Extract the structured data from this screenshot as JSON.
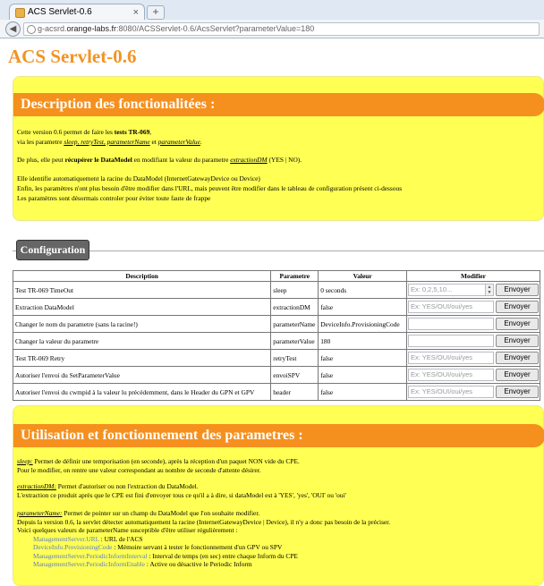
{
  "browser": {
    "tab_title": "ACS Servlet-0.6",
    "tab_close": "×",
    "new_tab": "+",
    "url_prefix": "g-acsrd.",
    "url_host": "orange-labs.fr",
    "url_rest": ":8080/ACSServlet-0.6/AcsServlet?parameterValue=180"
  },
  "page": {
    "title": "ACS Servlet-0.6",
    "description": {
      "heading": "Description des fonctionalitées :",
      "l1a": "Cette version 0.6 permet de faire les ",
      "l1b": "tests TR-069",
      "l1c": ",",
      "l2a": "via les parametre ",
      "l2b": "sleep, retryTest, parameterName",
      "l2c": " et ",
      "l2d": "parameterValue",
      "l2e": ".",
      "l3a": "De plus, elle peut ",
      "l3b": "récupérer le DataModel",
      "l3c": " en modifiant la valeur du parametre ",
      "l3d": "extractionDM",
      "l3e": " (YES | NO).",
      "l4": "Elle identifie automatiquement la racine du DataModel (InternetGatewayDevice ou Device)",
      "l5": "Enfin, les paramètres n'ont plus besoin d'être modifier dans l'URL, mais peuvent être modifier dans le tableau de configuration présent ci-dessous",
      "l6": "Les paramètres sont désormais controler pour éviter toute faute de frappe"
    },
    "configuration": {
      "label": "Configuration",
      "headers": [
        "Description",
        "Parametre",
        "Valeur",
        "Modifier"
      ],
      "button_label": "Envoyer",
      "rows": [
        {
          "desc": "Test TR-069 TimeOut",
          "param": "sleep",
          "value": "0 seconds",
          "placeholder": "Ex: 0,2,5,10...",
          "input_value": ""
        },
        {
          "desc": "Extraction DataModel",
          "param": "extractionDM",
          "value": "false",
          "placeholder": "Ex: YES/OUI/oui/yes",
          "input_value": ""
        },
        {
          "desc": "Changer le nom du parametre (sans la racine!)",
          "param": "parameterName",
          "value": "DeviceInfo.ProvisioningCode",
          "placeholder": "",
          "input_value": ""
        },
        {
          "desc": "Changer la valeur du parametre",
          "param": "parameterValue",
          "value": "180",
          "placeholder": "",
          "input_value": ""
        },
        {
          "desc": "Test TR-069 Retry",
          "param": "retryTest",
          "value": "false",
          "placeholder": "Ex: YES/OUI/oui/yes",
          "input_value": ""
        },
        {
          "desc": "Autoriser l'envoi du SetParameterValue",
          "param": "envoiSPV",
          "value": "false",
          "placeholder": "Ex: YES/OUI/oui/yes",
          "input_value": ""
        },
        {
          "desc": "Autoriser l'envoi du cwmpid à la valeur lu précédemment, dans le Header du GPN et GPV",
          "param": "header",
          "value": "false",
          "placeholder": "Ex: YES/OUI/oui/yes",
          "input_value": ""
        }
      ]
    },
    "usage": {
      "heading": "Utilisation et fonctionnement des parametres :",
      "sleep_label": "sleep:",
      "sleep_l1": " Permet de définir une temporisation (en seconde), après la réception d'un paquet NON vide du CPE.",
      "sleep_l2": "Pour le modifier, on rentre une valeur correspondant au nombre de seconde d'attente désirer.",
      "ext_label": "extractionDM:",
      "ext_l1": " Permet d'autoriser ou non l'extraction du DataModel.",
      "ext_l2": "L'extraction ce produit après que le CPE est fini d'envoyer tous ce qu'il a à dire, si dataModel est à 'YES', 'yes', 'OUI' ou 'oui'",
      "pn_label": "parameterName:",
      "pn_l1": " Permet de pointer sur un champ du DataModel que l'on souhaite modifier.",
      "pn_l2": "Depuis la version 0.6, la servlet détecter automatiquement la racine (InternetGatewayDevice | Device), il n'y a donc pas besoin de la préciser.",
      "pn_l3": "Voici quelques valeurs de parameterName susceptible d'être utiliser régulièrement :",
      "examples": [
        {
          "name": "ManagementServer.URL",
          "text": " : URL de l'ACS"
        },
        {
          "name": "DeviceInfo.ProvisioningCode",
          "text": " : Mémoire servant à tester le fonctionnement d'un GPV ou SPV"
        },
        {
          "name": "ManagementServer.PeriodicInformInterval",
          "text": " : Interval de temps (en sec) entre chaque Inform du CPE"
        },
        {
          "name": "ManagementServer.PeriodicInformEnable",
          "text": " : Active ou désactive le Periodic Inform"
        }
      ]
    }
  }
}
